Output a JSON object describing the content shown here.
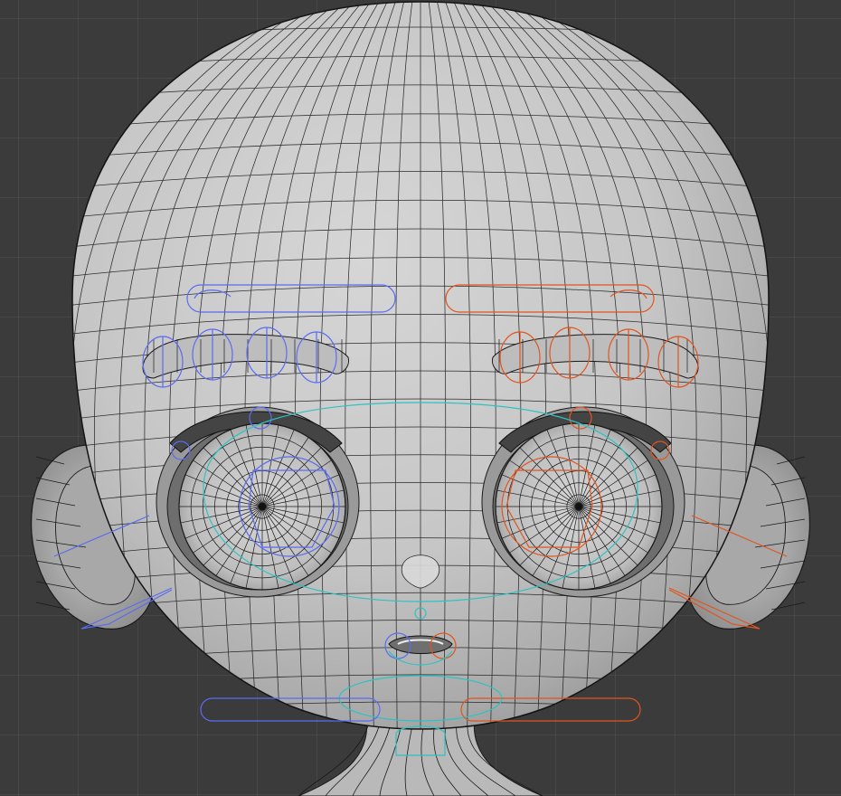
{
  "viewport": {
    "grid_color": "#4a4a4a",
    "background_color": "#3b3b3b",
    "mesh_base_color": "#cfcfcf",
    "wire_color": "#1a1a1a"
  },
  "scene": {
    "model": "stylized-cartoon-head",
    "view": "front-orthographic",
    "shading": "solid-with-wireframe"
  },
  "rig_controls": {
    "left_side_color": "#5a6cf0",
    "right_side_color": "#e0551f",
    "center_color": "#2ec2c2",
    "items": [
      "brow-control-left",
      "brow-control-right",
      "brow-segments-left",
      "brow-segments-right",
      "eye-control-left",
      "eye-control-right",
      "ear-control-left",
      "ear-control-right",
      "mouth-control",
      "jaw-control",
      "cheek-control-left",
      "cheek-control-right",
      "neck-control"
    ]
  }
}
